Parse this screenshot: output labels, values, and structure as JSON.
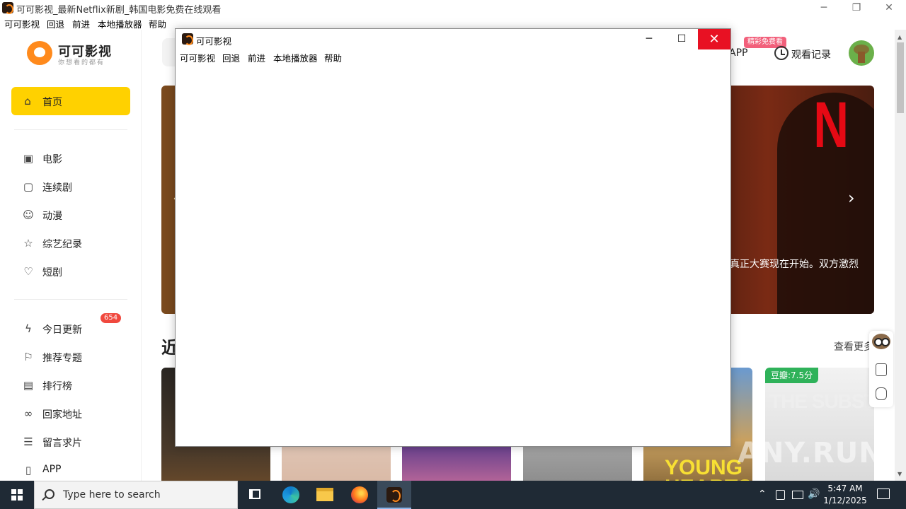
{
  "main_window": {
    "title": "可可影视_最新Netflix新剧_韩国电影免费在线观看",
    "controls": {
      "minimize": "─",
      "maximize": "❐",
      "close": "✕"
    }
  },
  "menubar": [
    "可可影视",
    "回退",
    "前进",
    "本地播放器",
    "帮助"
  ],
  "sidebar": {
    "logo_name": "可可影视",
    "logo_slogan": "你想看的都有",
    "home": {
      "label": "首页",
      "icon": "home-icon"
    },
    "group1": [
      {
        "label": "电影",
        "icon": "movie-icon"
      },
      {
        "label": "连续剧",
        "icon": "tv-icon"
      },
      {
        "label": "动漫",
        "icon": "anime-icon"
      },
      {
        "label": "综艺纪录",
        "icon": "star-icon"
      },
      {
        "label": "短剧",
        "icon": "heart-icon"
      }
    ],
    "group2": [
      {
        "label": "今日更新",
        "icon": "lightning-icon",
        "badge": "654"
      },
      {
        "label": "推荐专题",
        "icon": "flag-icon"
      },
      {
        "label": "排行榜",
        "icon": "ranking-icon"
      },
      {
        "label": "回家地址",
        "icon": "infinity-icon"
      },
      {
        "label": "留言求片",
        "icon": "message-icon"
      },
      {
        "label": "APP",
        "icon": "phone-icon"
      }
    ]
  },
  "header": {
    "promo_badge": "精彩免费看",
    "app_label": "APP",
    "history_label": "观看记录"
  },
  "banner": {
    "brand": "N",
    "caption": "真正大赛现在开始。双方激烈",
    "next": "›",
    "prev": "‹"
  },
  "section": {
    "title": "近",
    "see_more": "查看更多"
  },
  "posters": {
    "score": "豆瓣:7.5分",
    "substance_title": "THE SUBSTANCE",
    "young_hearts": "YOUNG HEARTS"
  },
  "dialog": {
    "title": "可可影视",
    "menubar": [
      "可可影视",
      "回退",
      "前进",
      "本地播放器",
      "帮助"
    ],
    "controls": {
      "minimize": "─",
      "maximize": "☐",
      "close": "✕"
    }
  },
  "taskbar": {
    "search_placeholder": "Type here to search",
    "time": "5:47 AM",
    "date": "1/12/2025",
    "tray": {
      "chevron": "⌃",
      "speaker": "🔊"
    }
  },
  "watermark": "ANY.RUN",
  "colors": {
    "accent": "#ffd100",
    "netflix_red": "#e50914",
    "badge_red": "#f0483e",
    "douban_green": "#2fb25a",
    "close_red": "#e81123"
  }
}
